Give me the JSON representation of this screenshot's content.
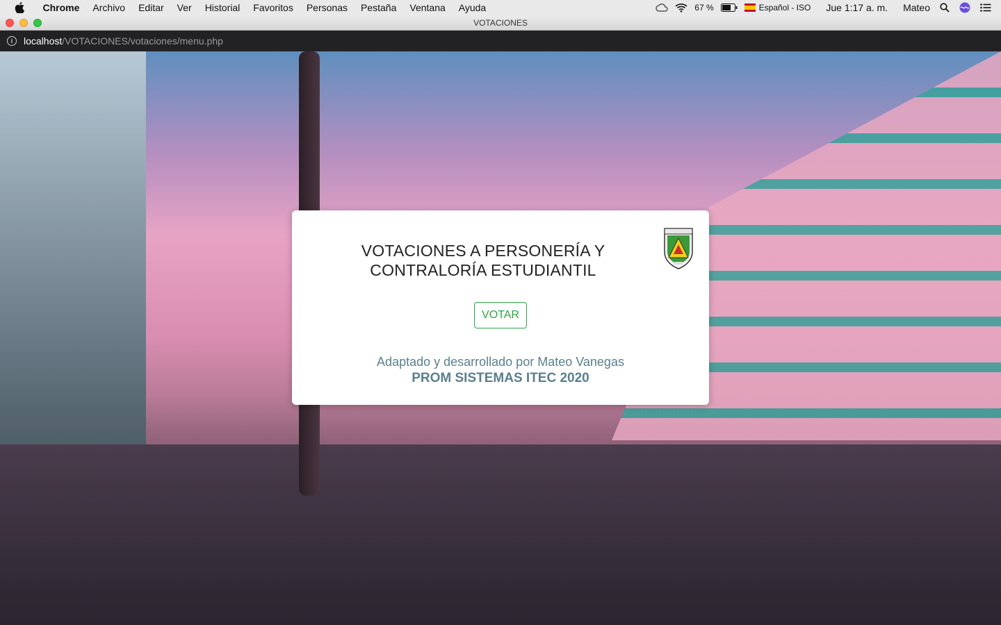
{
  "menubar": {
    "app_name": "Chrome",
    "items": [
      "Archivo",
      "Editar",
      "Ver",
      "Historial",
      "Favoritos",
      "Personas",
      "Pestaña",
      "Ventana",
      "Ayuda"
    ],
    "battery": "67 %",
    "input_source": "Español - ISO",
    "clock": "Jue 1:17 a. m.",
    "user": "Mateo"
  },
  "window": {
    "title": "VOTACIONES"
  },
  "address": {
    "host": "localhost",
    "path": "/VOTACIONES/votaciones/menu.php"
  },
  "card": {
    "title_line1": "VOTACIONES A PERSONERÍA Y",
    "title_line2": "CONTRALORÍA ESTUDIANTIL",
    "vote_label": "VOTAR",
    "credit_line": "Adaptado y desarrollado por Mateo Vanegas",
    "prom_line": "PROM SISTEMAS ITEC 2020",
    "accent_color": "#28a745",
    "credit_color": "#5a7f8c"
  }
}
